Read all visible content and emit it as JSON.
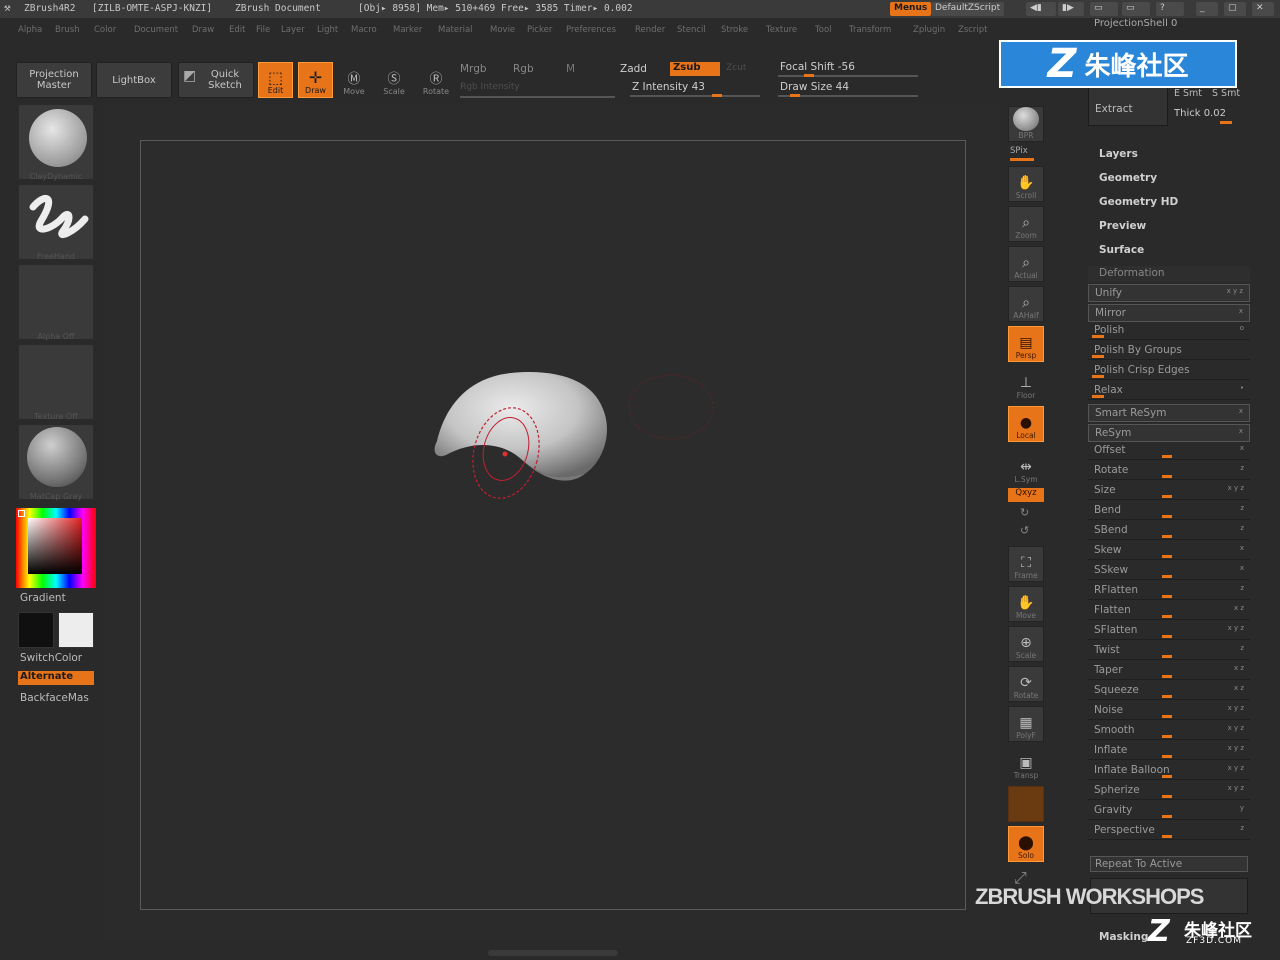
{
  "titlebar": {
    "app": "ZBrush4R2",
    "serial": "[ZILB-OMTE-ASPJ-KNZI]",
    "doc": "ZBrush Document",
    "stats": "[Obj▸ 8958]  Mem▸ 510+469  Free▸ 3585  Timer▸ 0.002",
    "menus_btn": "Menus",
    "script_btn": "DefaultZScript"
  },
  "menubar": [
    "Alpha",
    "Brush",
    "Color",
    "Document",
    "Draw",
    "Edit",
    "File",
    "Layer",
    "Light",
    "Macro",
    "Marker",
    "Material",
    "Movie",
    "Picker",
    "Preferences",
    "Render",
    "Stencil",
    "Stroke",
    "Texture",
    "Tool",
    "Transform",
    "Zplugin",
    "Zscript"
  ],
  "toolbar": {
    "projection_master": "Projection Master",
    "lightbox": "LightBox",
    "quick_sketch": "Quick Sketch",
    "edit": "Edit",
    "draw": "Draw",
    "move": "Move",
    "scale": "Scale",
    "rotate": "Rotate",
    "mrgb": "Mrgb",
    "rgb": "Rgb",
    "m": "M",
    "rgb_intensity": "Rgb Intensity",
    "zadd": "Zadd",
    "zsub": "Zsub",
    "zcut": "Zcut",
    "z_intensity": "Z Intensity 43",
    "focal_shift": "Focal Shift -56",
    "draw_size": "Draw Size 44"
  },
  "left": {
    "brush_label": "ClayDynamic",
    "stroke_label": "FreeHand",
    "alpha_label": "Alpha Off",
    "texture_label": "Texture Off",
    "material_label": "MatCap Gray",
    "gradient": "Gradient",
    "switchcolor": "SwitchColor",
    "alternate": "Alternate",
    "backface": "BackfaceMas"
  },
  "shelf": {
    "bpr": "BPR",
    "spix": "SPix",
    "scroll": "Scroll",
    "zoom": "Zoom",
    "actual": "Actual",
    "aahalf": "AAHalf",
    "persp": "Persp",
    "floor": "Floor",
    "local": "Local",
    "lsym": "L.Sym",
    "xyz": "Qxyz",
    "frame": "Frame",
    "move": "Move",
    "scale": "Scale",
    "rotate": "Rotate",
    "polyf": "PolyF",
    "transp": "Transp",
    "solo": "Solo"
  },
  "palette": {
    "projection_shell": "ProjectionShell 0",
    "extract": "Extract",
    "smt_a": "E Smt",
    "smt_b": "S Smt",
    "thick": "Thick 0.02",
    "sections": [
      "Layers",
      "Geometry",
      "Geometry HD",
      "Preview",
      "Surface"
    ],
    "deformation": "Deformation",
    "deform_items": [
      {
        "name": "Unify",
        "axes": "x y z"
      },
      {
        "name": "Mirror",
        "axes": "x"
      },
      {
        "name": "Polish",
        "axes": "o"
      },
      {
        "name": "Polish By Groups",
        "axes": ""
      },
      {
        "name": "Polish Crisp Edges",
        "axes": ""
      },
      {
        "name": "Relax",
        "axes": "•"
      },
      {
        "name": "Smart ReSym",
        "axes": "x"
      },
      {
        "name": "ReSym",
        "axes": "x"
      },
      {
        "name": "Offset",
        "axes": "x"
      },
      {
        "name": "Rotate",
        "axes": "z"
      },
      {
        "name": "Size",
        "axes": "x y z"
      },
      {
        "name": "Bend",
        "axes": "z"
      },
      {
        "name": "SBend",
        "axes": "z"
      },
      {
        "name": "Skew",
        "axes": "x"
      },
      {
        "name": "SSkew",
        "axes": "x"
      },
      {
        "name": "RFlatten",
        "axes": "z"
      },
      {
        "name": "Flatten",
        "axes": "x z"
      },
      {
        "name": "SFlatten",
        "axes": "x y z"
      },
      {
        "name": "Twist",
        "axes": "z"
      },
      {
        "name": "Taper",
        "axes": "x z"
      },
      {
        "name": "Squeeze",
        "axes": "x z"
      },
      {
        "name": "Noise",
        "axes": "x y z"
      },
      {
        "name": "Smooth",
        "axes": "x y z"
      },
      {
        "name": "Inflate",
        "axes": "x y z"
      },
      {
        "name": "Inflate Balloon",
        "axes": "x y z"
      },
      {
        "name": "Spherize",
        "axes": "x y z"
      },
      {
        "name": "Gravity",
        "axes": "y"
      },
      {
        "name": "Perspective",
        "axes": "z"
      }
    ],
    "repeat_to_active": "Repeat To Active",
    "masking": "Masking"
  },
  "watermark": {
    "top": "朱峰社区",
    "bottom": "ZBRUSH WORKSHOPS",
    "bottom2": "朱峰社区",
    "bottom3": "ZF3D.COM"
  }
}
